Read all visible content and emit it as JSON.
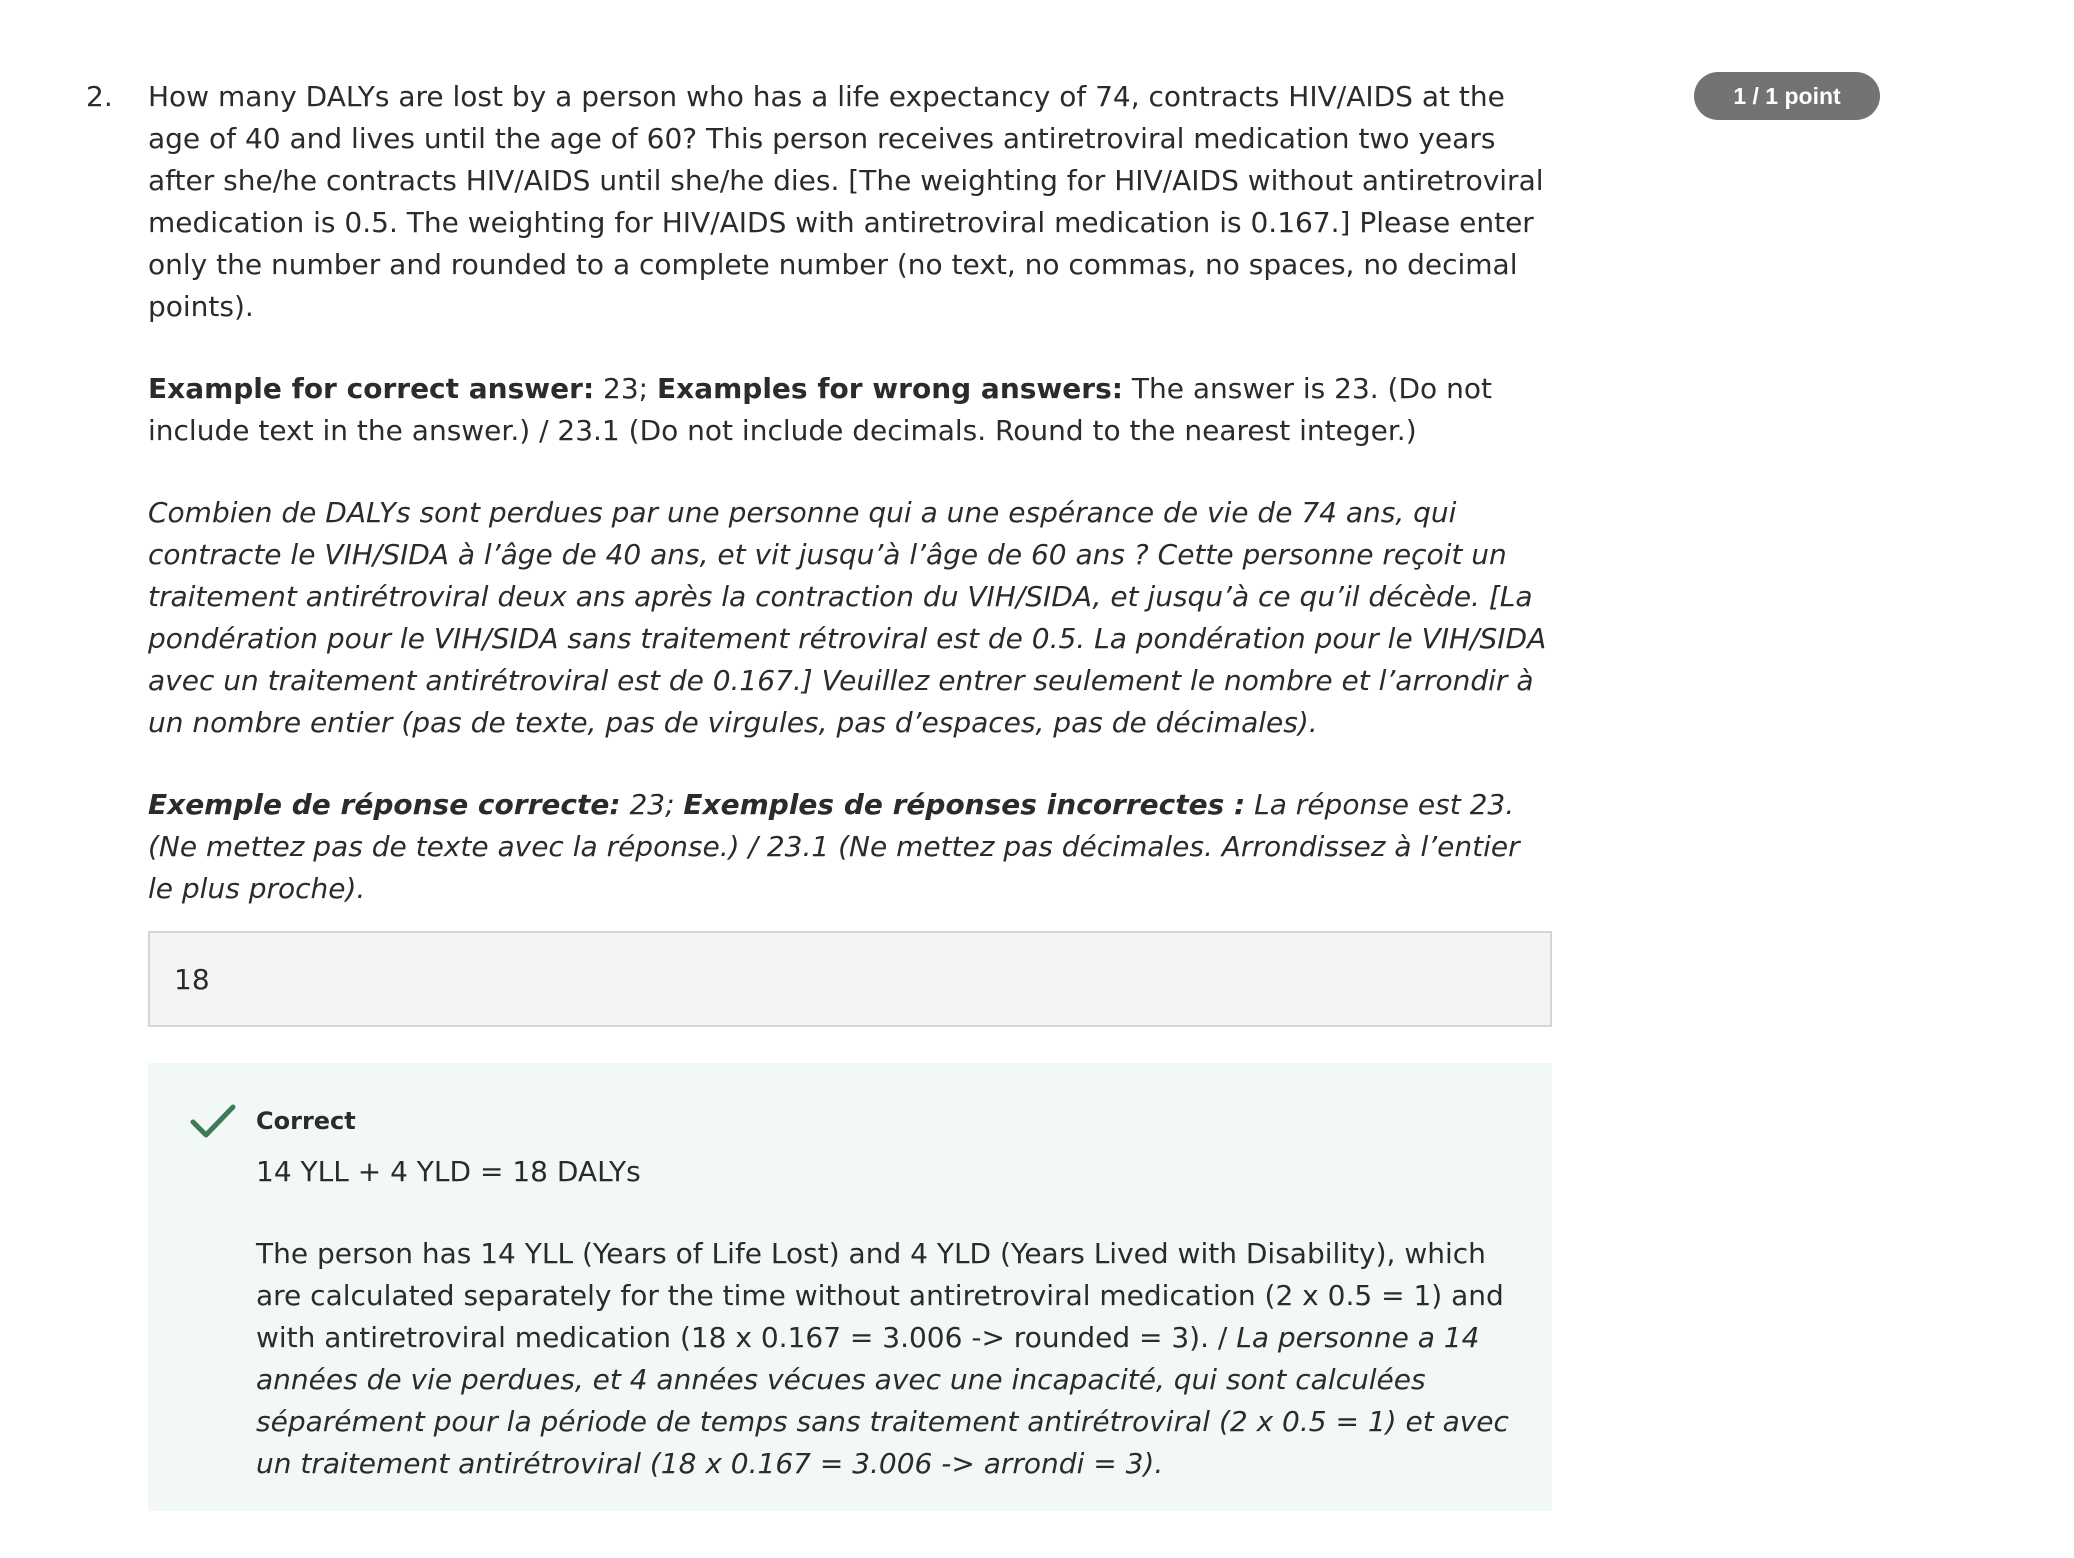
{
  "question": {
    "number": "2.",
    "en_text": "How many DALYs are lost by a person who has a life expectancy of 74, contracts HIV/AIDS at the age of 40 and lives until the age of 60? This person receives antiretroviral medication two years after she/he contracts HIV/AIDS until she/he dies. [The weighting for HIV/AIDS without antiretroviral medication is 0.5. The weighting for HIV/AIDS with antiretroviral medication is 0.167.] Please enter only the number and rounded to a complete number (no text, no commas, no spaces, no decimal points).",
    "en_example": {
      "correct_label": "Example for correct answer:",
      "correct_value": " 23; ",
      "wrong_label": "Examples for wrong answers:",
      "wrong_value": " The answer is 23. (Do not include text in the answer.) / 23.1 (Do not include decimals. Round to the nearest integer.)"
    },
    "fr_text": "Combien de DALYs sont perdues par une personne qui a une espérance de vie de 74 ans, qui contracte le VIH/SIDA à l’âge de 40 ans, et vit jusqu’à l’âge de 60 ans ? Cette personne reçoit un traitement antirétroviral deux ans après la contraction du VIH/SIDA, et jusqu’à ce qu’il décède. [La pondération pour le VIH/SIDA sans traitement rétroviral est de 0.5. La pondération pour le VIH/SIDA avec un traitement antirétroviral est de 0.167.] Veuillez entrer seulement le nombre et l’arrondir à un nombre entier (pas de texte, pas de virgules, pas d’espaces, pas de décimales).",
    "fr_example": {
      "correct_label": "Exemple de réponse correcte:",
      "correct_value": " 23; ",
      "wrong_label": "Exemples de réponses incorrectes :",
      "wrong_value": " La réponse est 23. (Ne mettez pas de texte avec la réponse.) / 23.1 (Ne mettez pas décimales. Arrondissez à l’entier le plus proche)."
    }
  },
  "score": {
    "label": "1 / 1 point",
    "badge_color": "#737373"
  },
  "answer": {
    "value": "18"
  },
  "feedback": {
    "status": "Correct",
    "summary": "14 YLL + 4 YLD = 18 DALYs",
    "explanation_en": "The person has 14 YLL (Years of Life Lost) and 4 YLD (Years Lived with Disability), which are calculated separately for the time without antiretroviral medication (2 x 0.5 = 1) and with antiretroviral medication (18 x 0.167 = 3.006 -> rounded = 3). / ",
    "explanation_fr": "La personne a 14 années de vie perdues, et 4 années vécues avec une incapacité, qui sont calculées séparément pour la période de temps sans traitement antirétroviral (2 x 0.5 = 1) et avec un traitement antirétroviral (18 x 0.167 = 3.006 -> arrondi = 3).",
    "icon": "check-icon",
    "accent_color": "#3d7a55",
    "background_color": "#f2f8f6"
  }
}
